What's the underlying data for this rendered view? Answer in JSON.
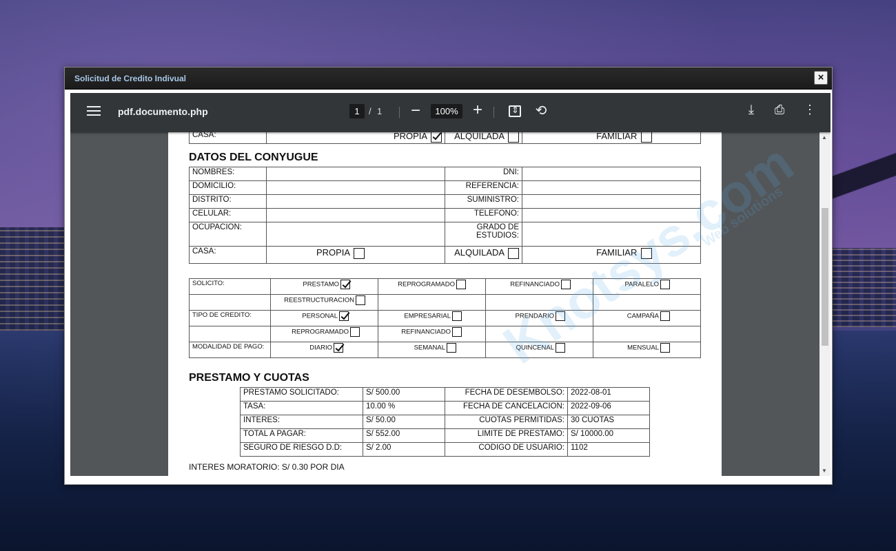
{
  "modal": {
    "title": "Solicitud de Credito Indivual",
    "close": "×"
  },
  "toolbar": {
    "filename": "pdf.documento.php",
    "page_current": "1",
    "page_sep": "/",
    "page_total": "1",
    "zoom": "100%",
    "icons": [
      "menu-icon",
      "zoom-out-icon",
      "zoom-in-icon",
      "fit-page-icon",
      "rotate-icon",
      "download-icon",
      "print-icon",
      "more-icon"
    ]
  },
  "top_row": {
    "label": "CASA:",
    "options": [
      {
        "label": "PROPIA",
        "checked": true
      },
      {
        "label": "ALQUILADA",
        "checked": false
      },
      {
        "label": "FAMILIAR",
        "checked": false
      }
    ]
  },
  "conyugue": {
    "title": "DATOS DEL CONYUGUE",
    "rows": [
      {
        "left": "NOMBRES:",
        "right": "DNI:"
      },
      {
        "left": "DOMICILIO:",
        "right": "REFERENCIA:"
      },
      {
        "left": "DISTRITO:",
        "right": "SUMINISTRO:"
      },
      {
        "left": "CELULAR:",
        "right": "TELEFONO:"
      },
      {
        "left": "OCUPACION:",
        "right": "GRADO DE ESTUDIOS:"
      }
    ],
    "casa_label": "CASA:",
    "casa_options": [
      {
        "label": "PROPIA",
        "checked": false
      },
      {
        "label": "ALQUILADA",
        "checked": false
      },
      {
        "label": "FAMILIAR",
        "checked": false
      }
    ]
  },
  "solicito": {
    "rows": [
      {
        "label": "SOLICITO:",
        "opts": [
          {
            "label": "PRESTAMO",
            "checked": true
          },
          {
            "label": "REPROGRAMADO",
            "checked": false
          },
          {
            "label": "REFINANCIADO",
            "checked": false
          },
          {
            "label": "PARALELO",
            "checked": false
          }
        ]
      },
      {
        "label": "",
        "opts": [
          {
            "label": "REESTRUCTURACION",
            "checked": false
          }
        ]
      },
      {
        "label": "TIPO DE CREDITO:",
        "opts": [
          {
            "label": "PERSONAL",
            "checked": true
          },
          {
            "label": "EMPRESARIAL",
            "checked": false
          },
          {
            "label": "PRENDARIO",
            "checked": false
          },
          {
            "label": "CAMPAÑA",
            "checked": false
          }
        ]
      },
      {
        "label": "",
        "opts": [
          {
            "label": "REPROGRAMADO",
            "checked": false
          },
          {
            "label": "REFINANCIADO",
            "checked": false
          }
        ]
      },
      {
        "label": "MODALIDAD DE PAGO:",
        "opts": [
          {
            "label": "DIARIO",
            "checked": true
          },
          {
            "label": "SEMANAL",
            "checked": false
          },
          {
            "label": "QUINCENAL",
            "checked": false
          },
          {
            "label": "MENSUAL",
            "checked": false
          }
        ]
      }
    ]
  },
  "prestamo": {
    "title": "PRESTAMO Y CUOTAS",
    "rows": [
      {
        "l1": "PRESTAMO SOLICITADO:",
        "v1": "S/ 500.00",
        "l2": "FECHA DE DESEMBOLSO:",
        "v2": "2022-08-01"
      },
      {
        "l1": "TASA:",
        "v1": "10.00 %",
        "l2": "FECHA DE CANCELACION:",
        "v2": "2022-09-06"
      },
      {
        "l1": "INTERES:",
        "v1": "S/ 50.00",
        "l2": "CUOTAS PERMITIDAS:",
        "v2": "30 CUOTAS"
      },
      {
        "l1": "TOTAL A PAGAR:",
        "v1": "S/ 552.00",
        "l2": "LIMITE DE PRESTAMO:",
        "v2": "S/ 10000.00"
      },
      {
        "l1": "SEGURO DE RIESGO D.D:",
        "v1": "S/ 2.00",
        "l2": "CODIGO DE USUARIO:",
        "v2": "1102"
      }
    ],
    "footer": "INTERES MORATORIO: S/ 0.30 POR DIA"
  },
  "watermark": {
    "text": "Knotsys.com",
    "sub": "Web solutions"
  }
}
